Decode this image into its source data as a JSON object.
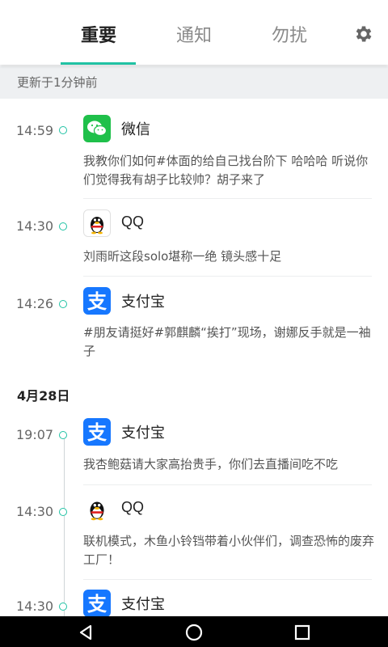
{
  "tabs": [
    {
      "label": "重要",
      "active": true
    },
    {
      "label": "通知",
      "active": false
    },
    {
      "label": "勿扰",
      "active": false
    }
  ],
  "settings_icon": "gear-icon",
  "updated_text": "更新于1分钟前",
  "accent_color": "#20c2a4",
  "today": [
    {
      "time": "14:59",
      "app": "微信",
      "icon": "wechat-icon",
      "message": "我教你们如何#体面的给自己找台阶下 哈哈哈 听说你们觉得我有胡子比较帅？胡子来了"
    },
    {
      "time": "14:30",
      "app": "QQ",
      "icon": "qq-penguin-icon",
      "message": "刘雨昕这段solo堪称一绝 镜头感十足"
    },
    {
      "time": "14:26",
      "app": "支付宝",
      "icon": "alipay-icon",
      "message": "#朋友请挺好#郭麒麟“挨打”现场，谢娜反手就是一袖子"
    }
  ],
  "date_header": "4月28日",
  "earlier": [
    {
      "time": "19:07",
      "app": "支付宝",
      "icon": "alipay-icon",
      "message": "我杏鲍菇请大家高抬贵手，你们去直播间吃不吃"
    },
    {
      "time": "14:30",
      "app": "QQ",
      "icon": "qq-penguin-icon",
      "message": "联机模式，木鱼小铃铛带着小伙伴们，调查恐怖的废弃工厂！"
    },
    {
      "time": "14:30",
      "app": "支付宝",
      "icon": "alipay-icon",
      "message": ""
    }
  ],
  "navbar": [
    "back-icon",
    "home-icon",
    "recents-icon"
  ]
}
